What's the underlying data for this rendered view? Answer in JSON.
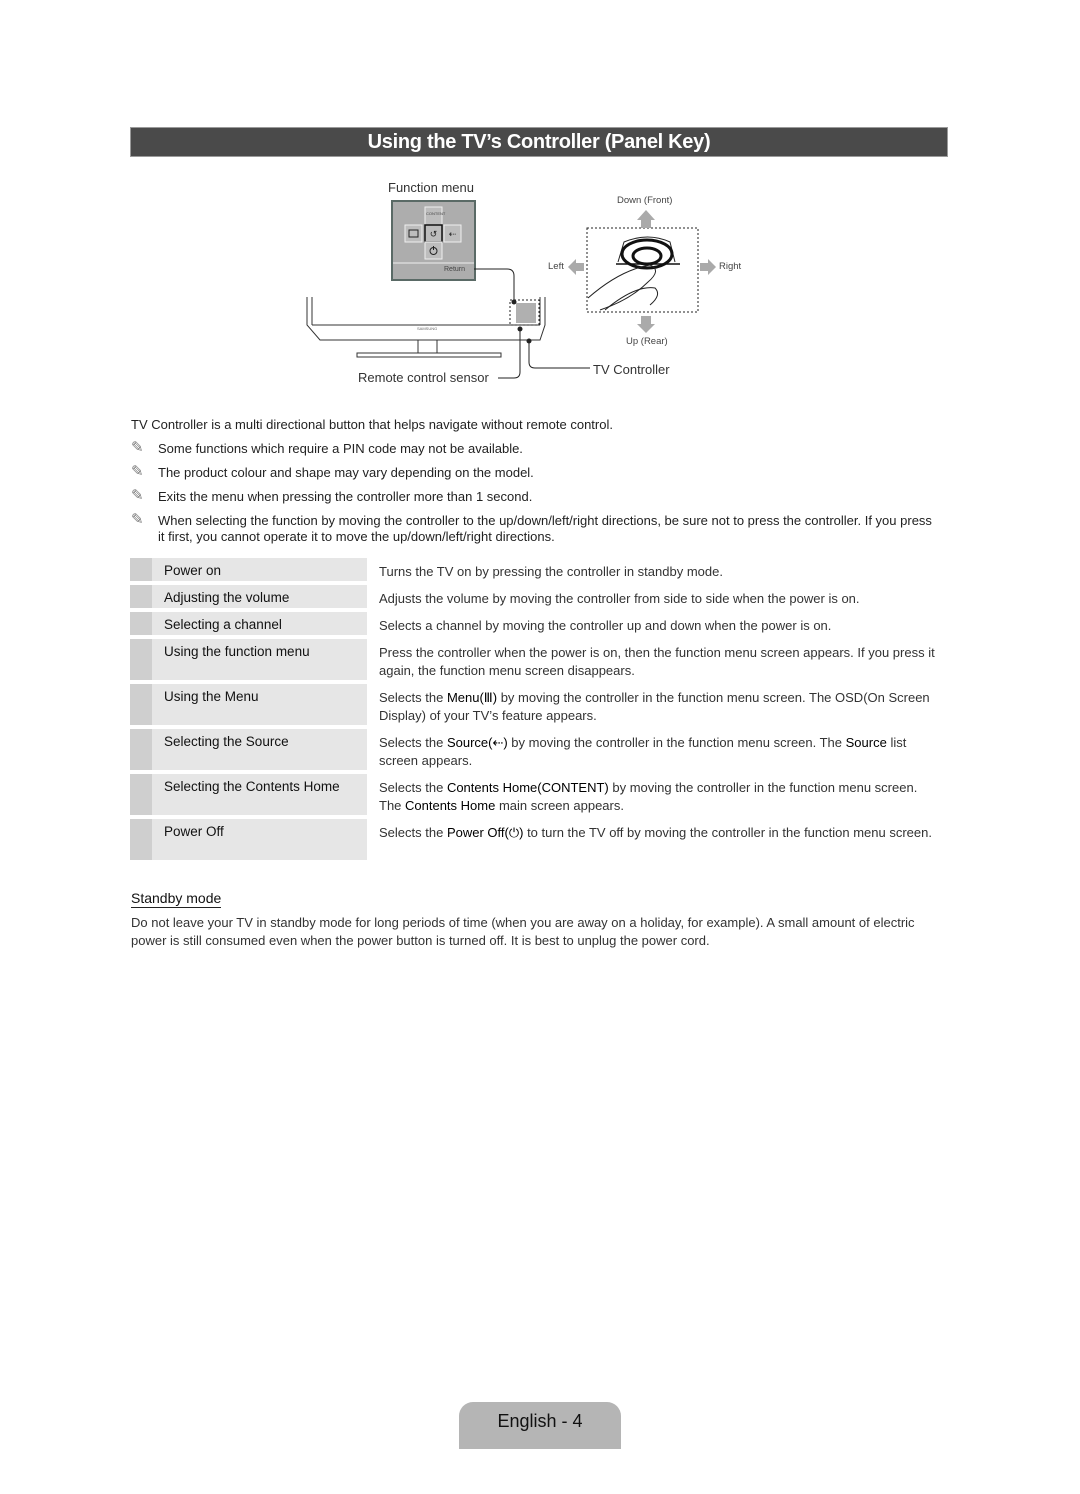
{
  "header": {
    "title": "Using the TV’s Controller (Panel Key)"
  },
  "diagram": {
    "function_menu_label": "Function menu",
    "menu_return_label": "Return",
    "menu_content_label": "CONTENT",
    "brand_label": "SAMSUNG",
    "remote_sensor_label": "Remote control sensor",
    "tv_controller_label": "TV Controller",
    "directions": {
      "down_front": "Down (Front)",
      "up_rear": "Up (Rear)",
      "left": "Left",
      "right": "Right"
    }
  },
  "intro": "TV Controller is a multi directional button that helps navigate without remote control.",
  "notes": [
    {
      "icon": "pencil-note-icon",
      "text": "Some functions which require a PIN code may not be available."
    },
    {
      "icon": "pencil-note-icon",
      "text": "The product colour and shape may vary depending on the model."
    },
    {
      "icon": "pencil-note-icon",
      "text": "Exits the menu when pressing the controller more than 1 second."
    },
    {
      "icon": "pencil-note-icon",
      "text": "When selecting the function by moving the controller to the up/down/left/right directions, be sure not to press the controller. If you press it first, you cannot operate it to move the up/down/left/right directions."
    }
  ],
  "functions": [
    {
      "label": "Power on",
      "desc_parts": [
        "Turns the TV on by pressing the controller in standby mode."
      ]
    },
    {
      "label": "Adjusting the volume",
      "desc_parts": [
        "Adjusts the volume by moving the controller from side to side when the power is on."
      ]
    },
    {
      "label": "Selecting a channel",
      "desc_parts": [
        "Selects a channel by moving the controller up and down when the power is on."
      ]
    },
    {
      "label": "Using the function menu",
      "desc_parts": [
        "Press the controller when the power is on, then the function menu screen appears. If you press it again, the function menu screen disappears."
      ]
    },
    {
      "label": "Using the Menu",
      "desc_parts": [
        "Selects the ",
        "Menu(Ⅲ)",
        " by moving the controller in the function menu screen. The OSD(On Screen Display) of your TV’s feature appears."
      ]
    },
    {
      "label": "Selecting the Source",
      "desc_parts": [
        "Selects the ",
        "Source(⇠)",
        " by moving the controller in the function menu screen. The ",
        "Source",
        " list screen appears."
      ]
    },
    {
      "label": "Selecting the Contents Home",
      "desc_parts": [
        "Selects the ",
        "Contents Home(CONTENT)",
        " by moving the controller in the function menu screen. The ",
        "Contents Home",
        " main screen appears."
      ]
    },
    {
      "label": "Power Off",
      "desc_parts": [
        "Selects the ",
        "Power Off(⏻)",
        " to turn the TV off by moving the controller in the function menu screen."
      ]
    }
  ],
  "standby": {
    "heading": "Standby mode",
    "text": "Do not leave your TV in standby mode for long periods of time (when you are away on a holiday, for example). A small amount of electric power is still consumed even when the power button is turned off. It is best to unplug the power cord."
  },
  "footer": {
    "page_label": "English - 4"
  },
  "colors": {
    "title_bar": "#4a4a4a",
    "row_bg": "#e6e6e6",
    "row_accent": "#cfcfcf",
    "footer_tab": "#b5b5b5"
  }
}
